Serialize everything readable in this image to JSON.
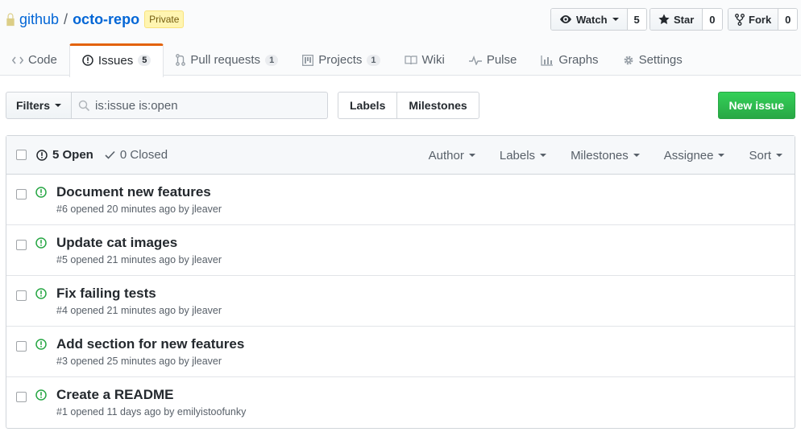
{
  "repo": {
    "owner": "github",
    "separator": "/",
    "name": "octo-repo",
    "badge": "Private"
  },
  "actions": {
    "watch_label": "Watch",
    "watch_count": "5",
    "star_label": "Star",
    "star_count": "0",
    "fork_label": "Fork",
    "fork_count": "0"
  },
  "tabs": [
    {
      "label": "Code",
      "icon": "code-icon"
    },
    {
      "label": "Issues",
      "icon": "issue-icon",
      "counter": "5",
      "selected": true
    },
    {
      "label": "Pull requests",
      "icon": "pull-request-icon",
      "counter": "1"
    },
    {
      "label": "Projects",
      "icon": "project-icon",
      "counter": "1"
    },
    {
      "label": "Wiki",
      "icon": "book-icon"
    },
    {
      "label": "Pulse",
      "icon": "pulse-icon"
    },
    {
      "label": "Graphs",
      "icon": "graph-icon"
    },
    {
      "label": "Settings",
      "icon": "gear-icon"
    }
  ],
  "subnav": {
    "filters_label": "Filters",
    "search_value": "is:issue is:open",
    "labels_label": "Labels",
    "milestones_label": "Milestones",
    "new_issue_label": "New issue"
  },
  "states": {
    "open_label": "5 Open",
    "closed_label": "0 Closed"
  },
  "menus": [
    "Author",
    "Labels",
    "Milestones",
    "Assignee",
    "Sort"
  ],
  "issues": [
    {
      "title": "Document new features",
      "meta": "#6 opened 20 minutes ago by ",
      "author": "jleaver"
    },
    {
      "title": "Update cat images",
      "meta": "#5 opened 21 minutes ago by ",
      "author": "jleaver"
    },
    {
      "title": "Fix failing tests",
      "meta": "#4 opened 21 minutes ago by ",
      "author": "jleaver"
    },
    {
      "title": "Add section for new features",
      "meta": "#3 opened 25 minutes ago by ",
      "author": "jleaver"
    },
    {
      "title": "Create a README",
      "meta": "#1 opened 11 days ago by ",
      "author": "emilyistoofunky"
    }
  ],
  "colors": {
    "accent_blue": "#0366d6",
    "tab_selected_border": "#e36209",
    "open_green": "#28a745",
    "private_badge_bg": "#fff5b1"
  }
}
